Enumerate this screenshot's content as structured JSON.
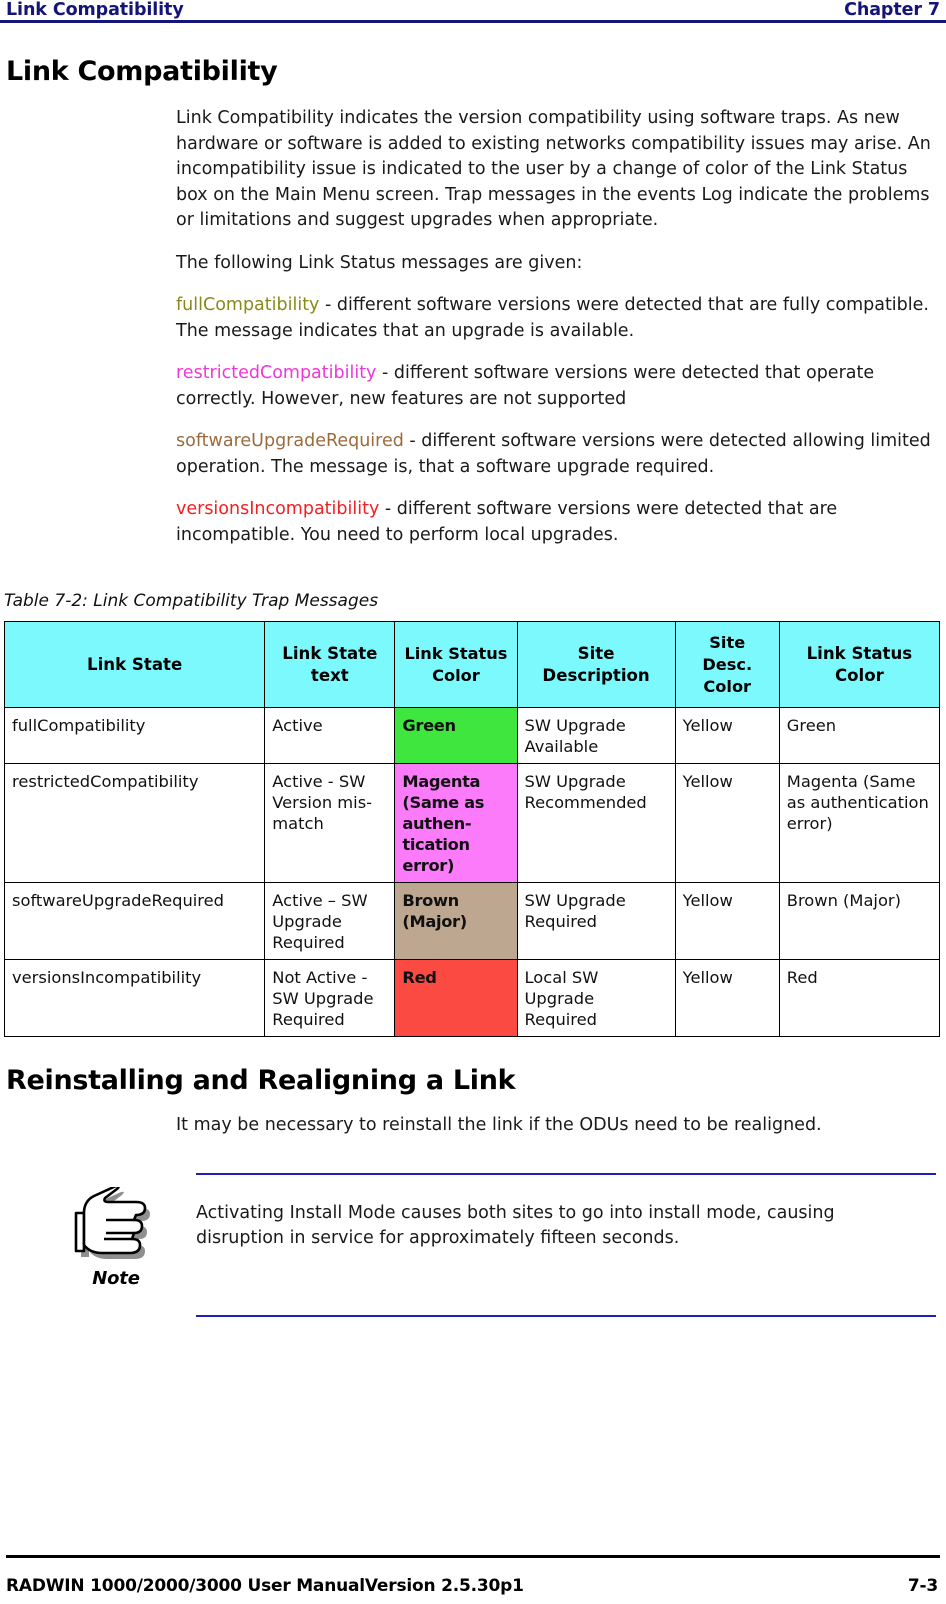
{
  "header": {
    "left_title": "Link Compatibility",
    "right_title": "Chapter 7",
    "rule_color": "#141479"
  },
  "section": {
    "title": "Link Compatibility",
    "intro": "Link Compatibility indicates the version compatibility using software traps. As new hardware or software is added to existing networks compatibility issues may arise. An incompatibility issue is indicated to the user by a change of color of the Link Status box on the Main Menu screen. Trap messages in the events Log indicate the problems or limitations and suggest upgrades when appropriate.",
    "lead_in": "The following Link Status messages are given:",
    "messages": [
      {
        "term": "fullCompatibility",
        "color": "#8a8a1c",
        "description": " - different software versions were detected that are fully compatible. The message indicates that an upgrade is available."
      },
      {
        "term": "restrictedCompatibility",
        "color": "#ef37d8",
        "description": " - different software versions were detected that operate correctly. However, new features are not supported"
      },
      {
        "term": "softwareUpgradeRequired",
        "color": "#9b6b3c",
        "description": " - different software versions were detected allowing limited operation. The message is, that a software upgrade required."
      },
      {
        "term": "versionsIncompatibility",
        "color": "#f42020",
        "description": " - different software versions were detected that are incompatible. You need to perform local upgrades."
      }
    ]
  },
  "table": {
    "caption": "Table 7-2: Link Compatibility Trap Messages",
    "header_bg": "#7bf9fd",
    "columns": [
      "Link State",
      "Link State text",
      "Link Status Color",
      "Site Description",
      "Site Desc. Color",
      "Link Status Color"
    ],
    "rows": [
      {
        "link_state": "fullCompatibility",
        "link_state_text": "Active",
        "link_status_color_label": "Green",
        "link_status_color_hex": "#3ee63e",
        "site_description": "SW Upgrade Available",
        "site_desc_color": "Yellow",
        "link_status_color_text": "Green"
      },
      {
        "link_state": "restrictedCompatibility",
        "link_state_text": "Active - SW Version mis-match",
        "link_status_color_label": "Magenta (Same as authen-tication error)",
        "link_status_color_hex": "#fb7bfb",
        "site_description": "SW Upgrade Recommended",
        "site_desc_color": "Yellow",
        "link_status_color_text": "Magenta (Same as authentication error)"
      },
      {
        "link_state": "softwareUpgradeRequired",
        "link_state_text": "Active – SW Upgrade Required",
        "link_status_color_label": "Brown (Major)",
        "link_status_color_hex": "#bda790",
        "site_description": "SW Upgrade Required",
        "site_desc_color": "Yellow",
        "link_status_color_text": "Brown (Major)"
      },
      {
        "link_state": "versionsIncompatibility",
        "link_state_text": "Not Active - SW Upgrade Required",
        "link_status_color_label": "Red",
        "link_status_color_hex": "#fb4a42",
        "site_description": "Local SW Upgrade Required",
        "site_desc_color": "Yellow",
        "link_status_color_text": "Red"
      }
    ]
  },
  "reinstall": {
    "title": "Reinstalling and Realigning a Link",
    "intro": "It may be necessary to reinstall the link if the ODUs need to be realigned."
  },
  "note": {
    "icon": "pointing-hand-icon",
    "label": "Note",
    "text": "Activating Install Mode causes both sites to go into install mode, causing disruption in service for approximately fifteen seconds.",
    "rule_color": "#1f1fb4"
  },
  "footer": {
    "left": "RADWIN 1000/2000/3000 User ManualVersion  2.5.30p1",
    "page_number": "7-3"
  }
}
